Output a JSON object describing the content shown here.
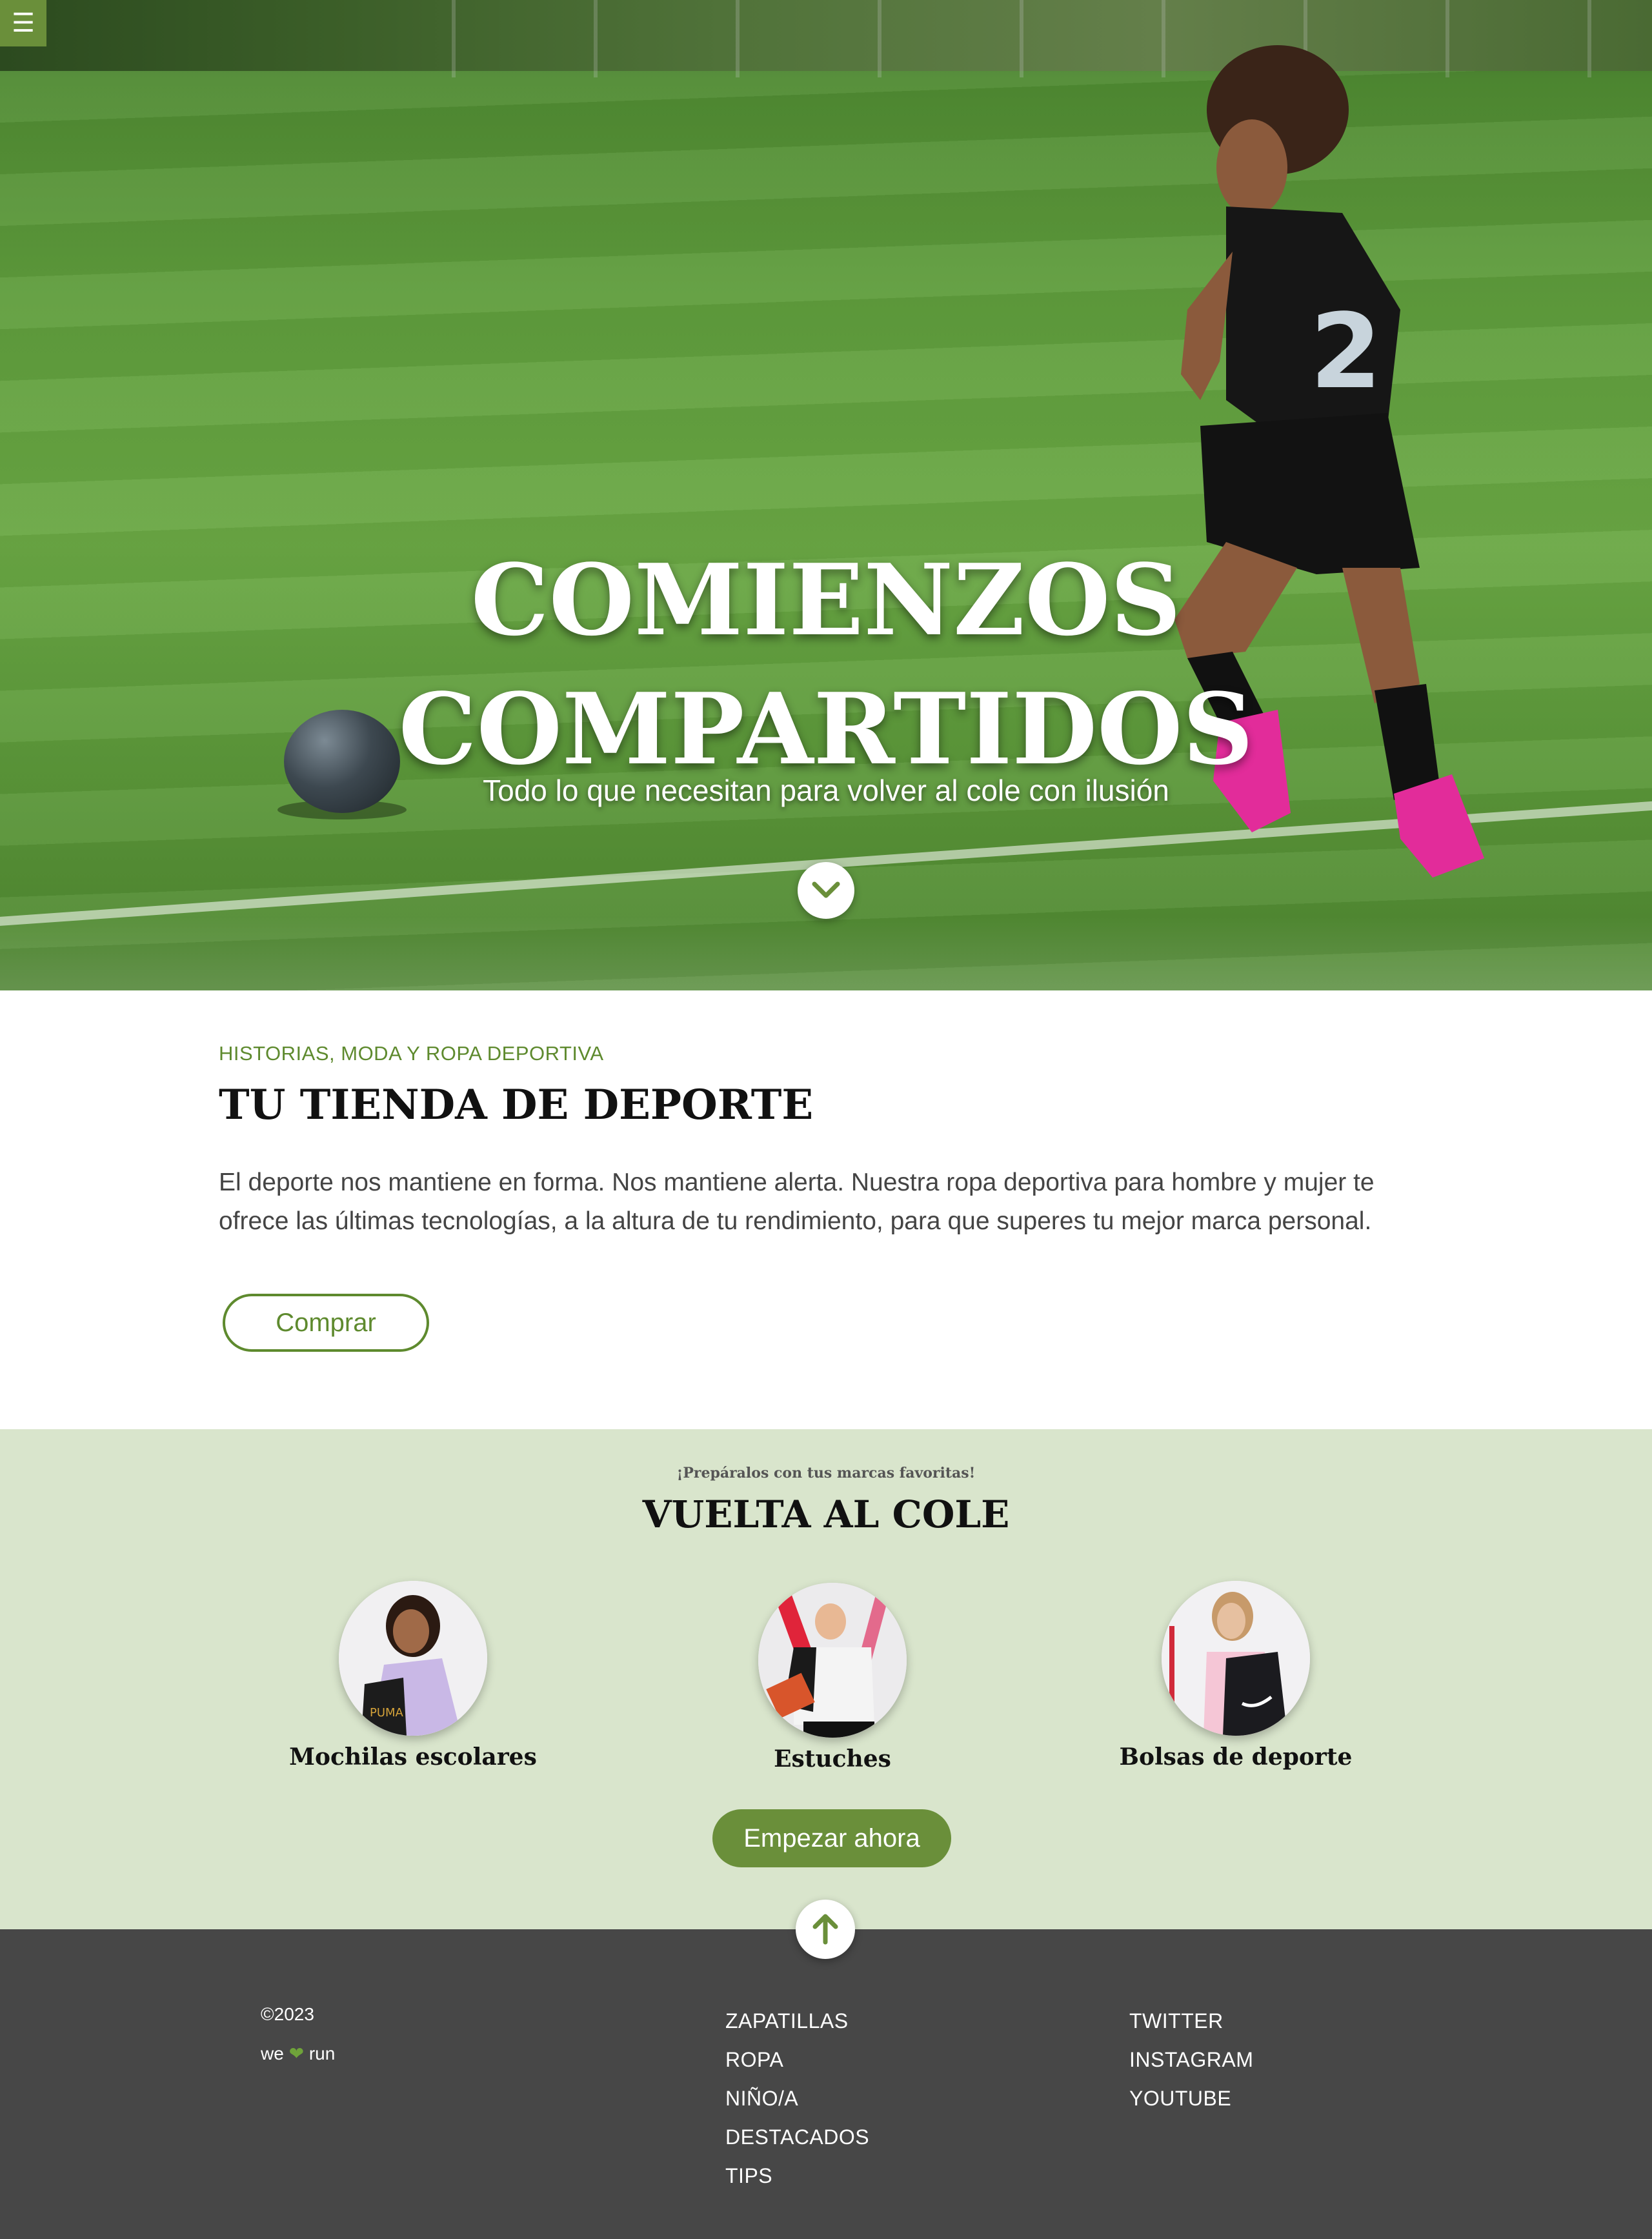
{
  "header": {
    "menu_icon": "☰"
  },
  "hero": {
    "title_line1": "COMIENZOS",
    "title_line2": "COMPARTIDOS",
    "subtitle": "Todo lo que necesitan para volver al cole con ilusión",
    "scroll_icon": "chevron-down-icon"
  },
  "intro": {
    "eyebrow": "HISTORIAS, MODA Y ROPA DEPORTIVA",
    "title": "TU TIENDA DE DEPORTE",
    "text": "El deporte nos mantiene en forma. Nos mantiene alerta. Nuestra ropa deportiva para hombre y mujer te ofrece las últimas tecnologías, a la altura de tu rendimiento, para que superes tu mejor marca personal.",
    "button": "Comprar"
  },
  "school": {
    "kicker": "¡Prepáralos con tus marcas favoritas!",
    "title": "VUELTA AL COLE",
    "categories": [
      {
        "label": "Mochilas escolares"
      },
      {
        "label": "Estuches"
      },
      {
        "label": "Bolsas de deporte"
      }
    ],
    "button": "Empezar ahora"
  },
  "footer": {
    "copyright": "©2023",
    "tagline_we": "we",
    "tagline_heart": "❤",
    "tagline_run": "run",
    "links_shop": [
      "ZAPATILLAS",
      "ROPA",
      "NIÑO/A",
      "DESTACADOS",
      "TIPS"
    ],
    "links_social": [
      "TWITTER",
      "INSTAGRAM",
      "YOUTUBE"
    ]
  },
  "colors": {
    "accent_green": "#6a8f3a",
    "section_bg": "#d9e5cc",
    "footer_bg": "#474747"
  }
}
